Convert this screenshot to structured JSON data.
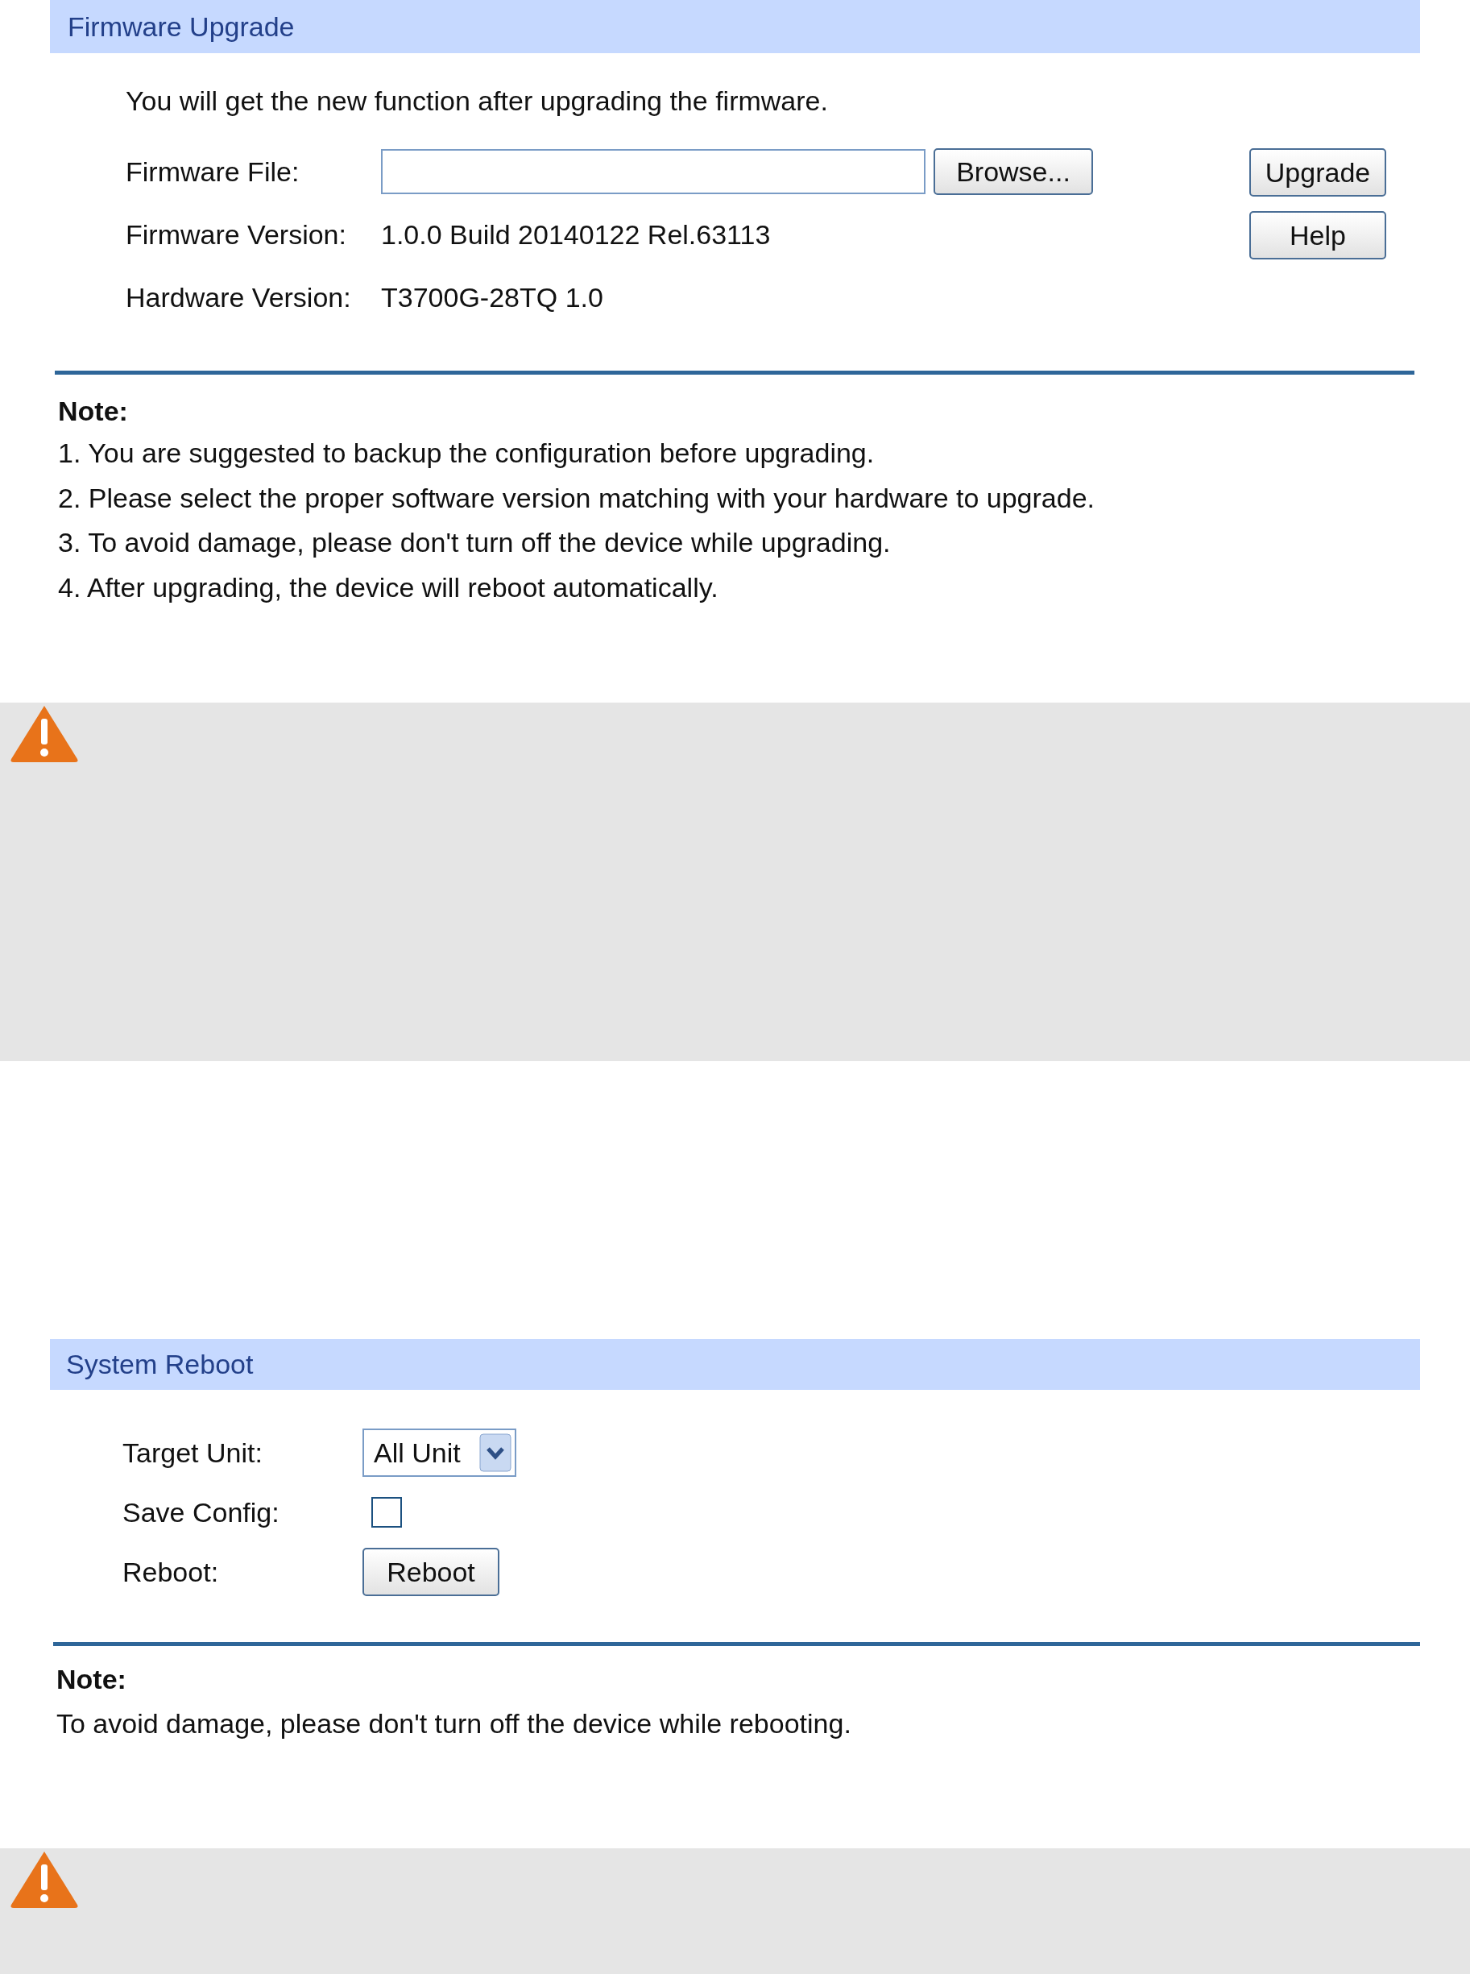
{
  "firmware": {
    "title": "Firmware Upgrade",
    "intro": "You will get the new function after upgrading the firmware.",
    "file_label": "Firmware File:",
    "browse": "Browse...",
    "version_label": "Firmware Version:",
    "version": "1.0.0 Build 20140122 Rel.63113",
    "hardware_label": "Hardware Version:",
    "hardware": "T3700G-28TQ 1.0",
    "buttons": [
      "Upgrade",
      "Help"
    ],
    "note_title": "Note:",
    "notes": [
      "1. You are suggested to backup the configuration before upgrading.",
      "2. Please select the proper software version matching with your hardware to upgrade.",
      "3. To avoid damage, please don't turn off the device while upgrading.",
      "4. After upgrading, the device will reboot automatically."
    ]
  },
  "reboot": {
    "title": "System Reboot",
    "target_label": "Target Unit:",
    "target_value": "All Unit",
    "save_label": "Save Config:",
    "save_checked": false,
    "reboot_label": "Reboot:",
    "reboot_button": "Reboot",
    "note_title": "Note:",
    "notes": [
      "To avoid damage, please don't turn off the device while rebooting."
    ]
  }
}
